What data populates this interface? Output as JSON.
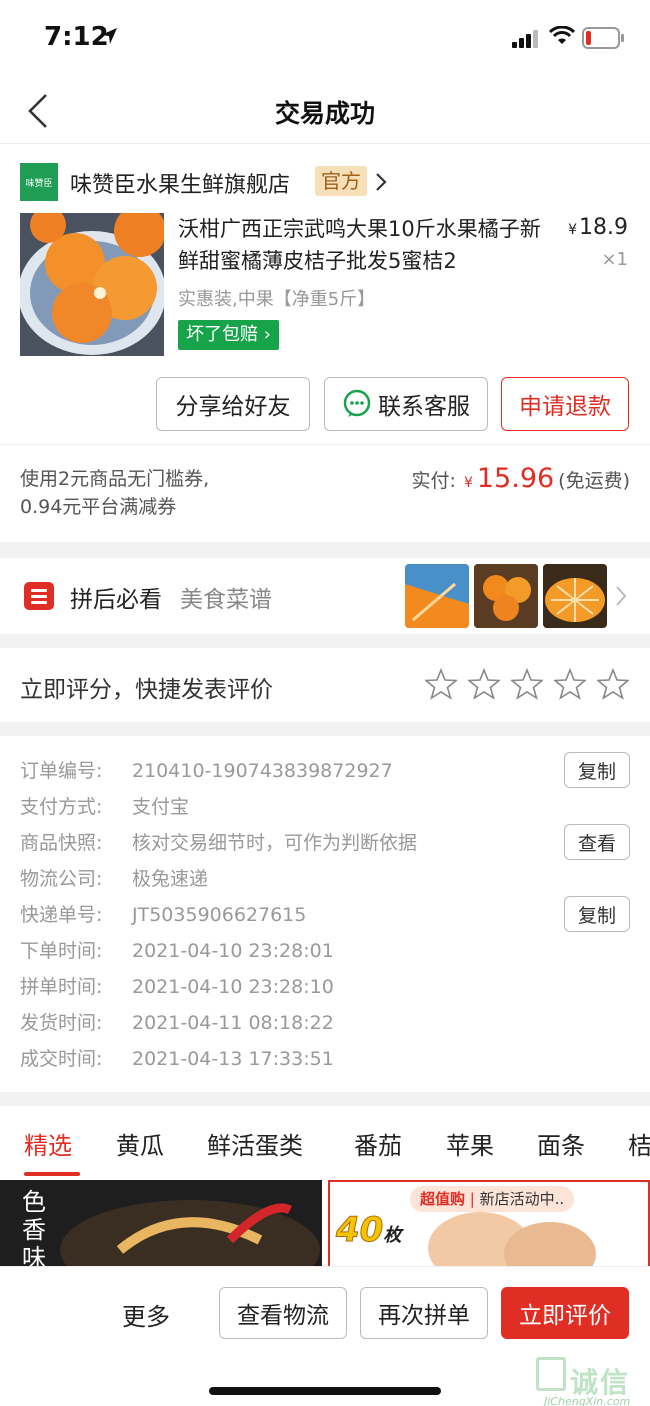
{
  "status_bar": {
    "time": "7:12"
  },
  "nav": {
    "title": "交易成功"
  },
  "store": {
    "logo_text": "味赞臣",
    "name": "味赞臣水果生鲜旗舰店",
    "badge": "官方"
  },
  "product": {
    "title": "沃柑广西正宗武鸣大果10斤水果橘子新鲜甜蜜橘薄皮桔子批发5蜜桔2",
    "price_symbol": "¥",
    "price": "18.9",
    "quantity": "×1",
    "spec": "实惠装,中果【净重5斤】",
    "guarantee": "坏了包赔"
  },
  "actions": {
    "share": "分享给好友",
    "contact": "联系客服",
    "refund": "申请退款"
  },
  "payment": {
    "discount_line1": "使用2元商品无门槛券,",
    "discount_line2": "0.94元平台满减券",
    "paid_label": "实付:",
    "currency": "¥",
    "amount": "15.96",
    "shipping": "(免运费)"
  },
  "recipe": {
    "title": "拼后必看",
    "subtitle": "美食菜谱"
  },
  "rating": {
    "label": "立即评分，快捷发表评价",
    "stars": 5,
    "filled": 0
  },
  "order_info": {
    "rows": [
      {
        "label": "订单编号:",
        "value": "210410-190743839872927",
        "action": "复制"
      },
      {
        "label": "支付方式:",
        "value": "支付宝"
      },
      {
        "label": "商品快照:",
        "value": "核对交易细节时，可作为判断依据",
        "action": "查看"
      },
      {
        "label": "物流公司:",
        "value": "极兔速递"
      },
      {
        "label": "快递单号:",
        "value": "JT5035906627615",
        "action": "复制"
      },
      {
        "label": "下单时间:",
        "value": "2021-04-10 23:28:01"
      },
      {
        "label": "拼单时间:",
        "value": "2021-04-10 23:28:10"
      },
      {
        "label": "发货时间:",
        "value": "2021-04-11 08:18:22"
      },
      {
        "label": "成交时间:",
        "value": "2021-04-13 17:33:51"
      }
    ]
  },
  "tabs": [
    "精选",
    "黄瓜",
    "鲜活蛋类",
    "番茄",
    "苹果",
    "面条",
    "桔"
  ],
  "feed": {
    "left_text": "色香味",
    "promo_badge": "超值购",
    "promo_text": "新店活动中..",
    "promo_count": "40",
    "promo_unit": "枚"
  },
  "bottom_bar": {
    "more": "更多",
    "logistics": "查看物流",
    "reorder": "再次拼单",
    "review": "立即评价"
  },
  "watermark": {
    "text": "诚信",
    "url": "JiChengXin.com"
  },
  "colors": {
    "accent": "#e02e24",
    "green": "#16a34a",
    "badge_bg": "#f7dfb8"
  }
}
